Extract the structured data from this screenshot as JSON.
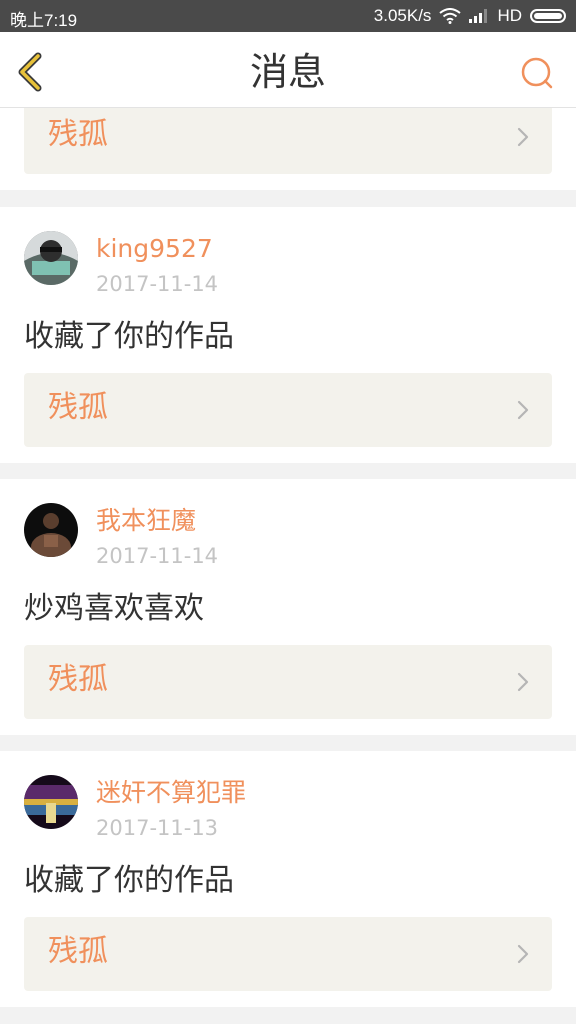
{
  "status_bar": {
    "time": "晚上7:19",
    "speed": "3.05K/s",
    "network": "HD"
  },
  "nav": {
    "title": "消息",
    "back_icon": "chevron-left-icon",
    "search_icon": "search-icon"
  },
  "colors": {
    "accent": "#f0905c",
    "back_icon": "#e8c23a",
    "link_box_bg": "#f3f2ec"
  },
  "partial_card": {
    "link_label": "残孤"
  },
  "messages": [
    {
      "username": "king9527",
      "date": "2017-11-14",
      "text": "收藏了你的作品",
      "link_label": "残孤"
    },
    {
      "username": "我本狂魔",
      "date": "2017-11-14",
      "text": "炒鸡喜欢喜欢",
      "link_label": "残孤"
    },
    {
      "username": "迷奸不算犯罪",
      "date": "2017-11-13",
      "text": "收藏了你的作品",
      "link_label": "残孤"
    }
  ]
}
